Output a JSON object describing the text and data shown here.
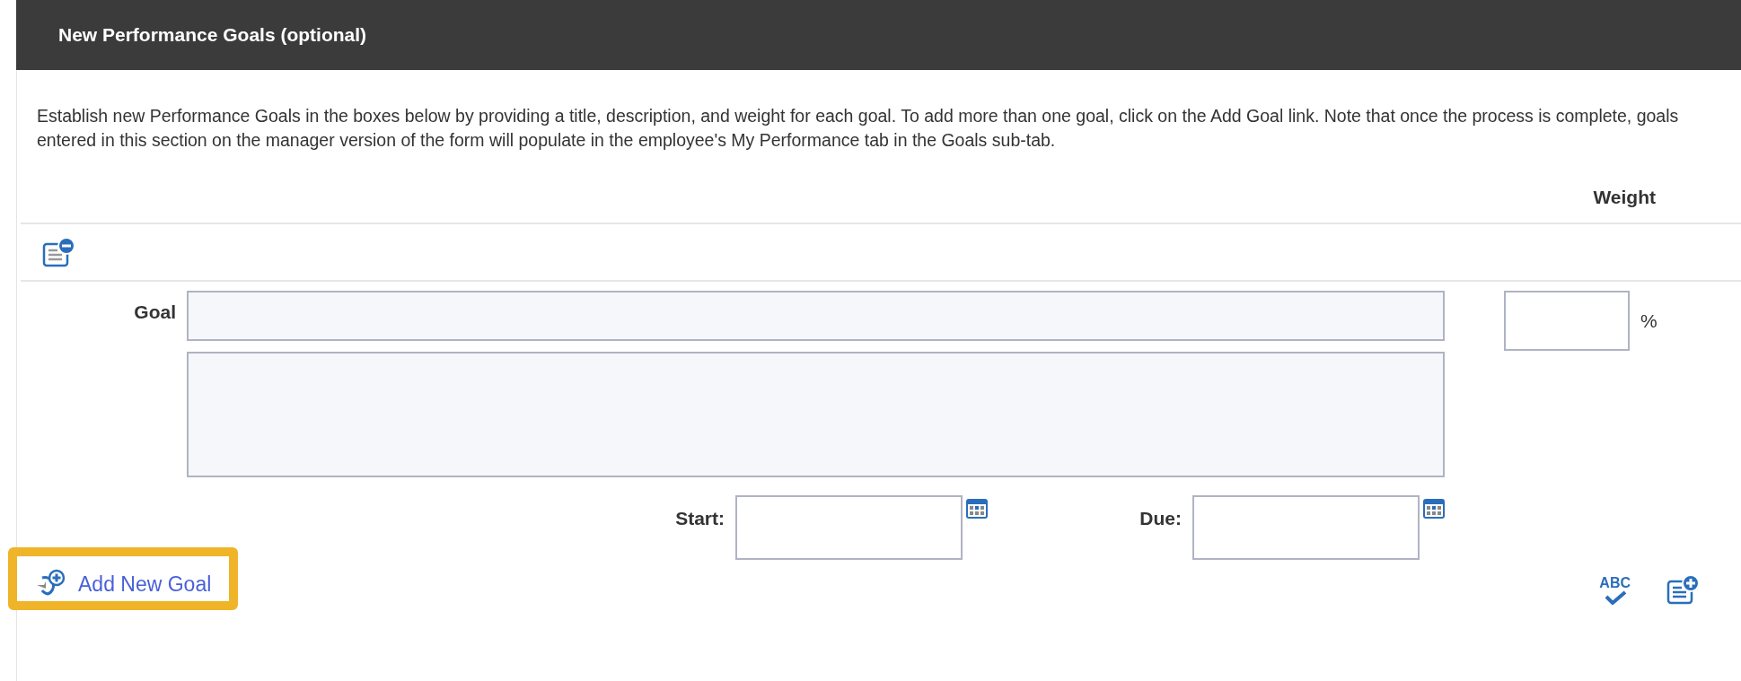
{
  "section": {
    "title": "New Performance Goals (optional)"
  },
  "instructions": "Establish new Performance Goals in the boxes below by providing a title, description, and weight for each goal. To add more than one goal, click on the Add Goal link. Note that once the process is complete, goals entered in this section on the manager version of the form will populate in the employee's My Performance tab in the Goals sub-tab.",
  "weight_header": "Weight",
  "goal": {
    "label": "Goal",
    "percent": "%",
    "start_label": "Start:",
    "due_label": "Due:"
  },
  "add_goal_link": {
    "label": "Add New Goal",
    "highlighted": true
  },
  "spellcheck_label": "ABC"
}
